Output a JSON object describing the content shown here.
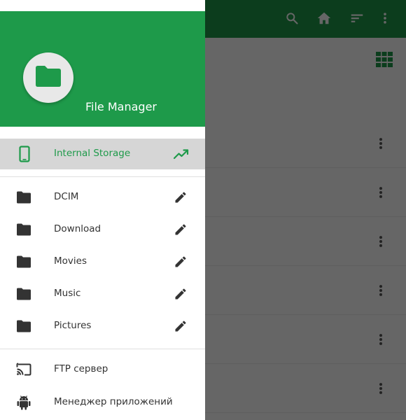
{
  "drawer": {
    "app_title": "File Manager",
    "storage": {
      "label": "Internal Storage",
      "icon": "phone-icon",
      "trend_icon": "trending-up-icon"
    },
    "folders": [
      {
        "label": "DCIM",
        "icon": "folder-icon",
        "action_icon": "edit-pencil-icon"
      },
      {
        "label": "Download",
        "icon": "folder-icon",
        "action_icon": "edit-pencil-icon"
      },
      {
        "label": "Movies",
        "icon": "folder-icon",
        "action_icon": "edit-pencil-icon"
      },
      {
        "label": "Music",
        "icon": "folder-icon",
        "action_icon": "edit-pencil-icon"
      },
      {
        "label": "Pictures",
        "icon": "folder-icon",
        "action_icon": "edit-pencil-icon"
      }
    ],
    "extras": [
      {
        "label": "FTP сервер",
        "icon": "ftp-cast-icon"
      },
      {
        "label": "Менеджер приложений",
        "icon": "android-icon"
      }
    ]
  },
  "toolbar": {
    "icons": [
      "search-icon",
      "home-icon",
      "sort-icon",
      "more-vert-icon"
    ]
  },
  "background_list": {
    "view_toggle_icon": "grid-view-icon",
    "row_action_icon": "more-vert-icon"
  },
  "colors": {
    "primary": "#1e9a4a",
    "selected_bg": "#d6d6d6",
    "icon_dark": "#333333",
    "scrim": "rgba(0,0,0,0.60)"
  }
}
